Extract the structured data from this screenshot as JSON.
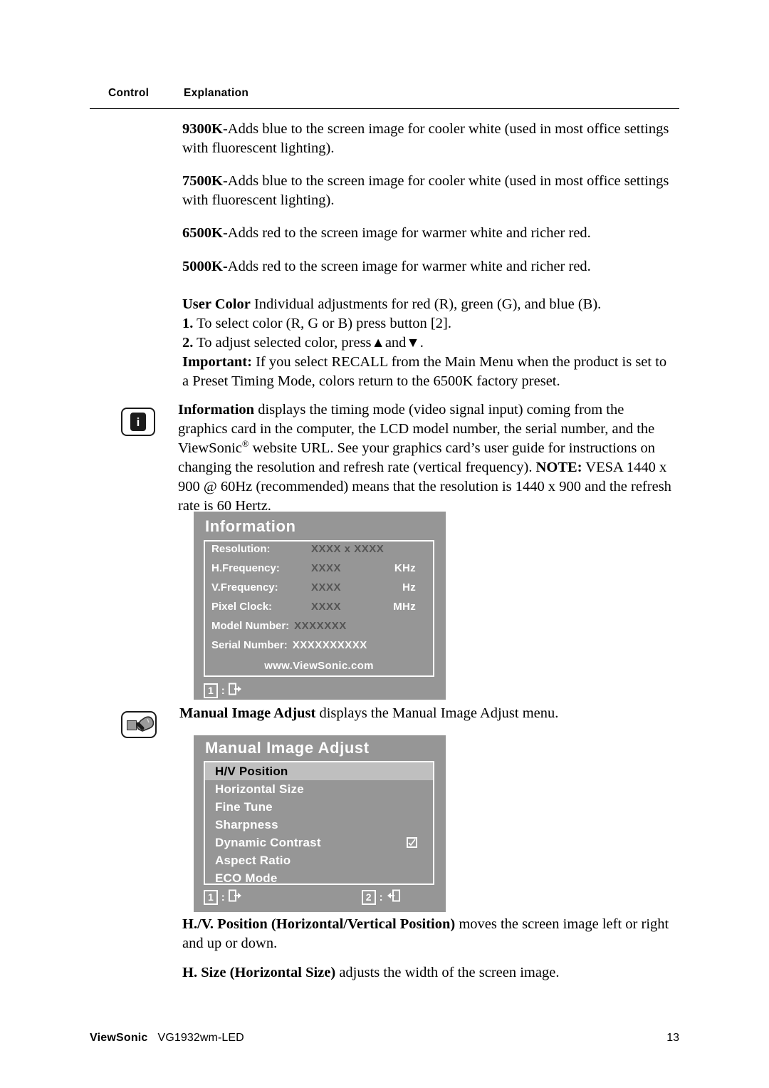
{
  "table_header": {
    "control": "Control",
    "explanation": "Explanation"
  },
  "paragraphs": {
    "p_9300k_term": "9300K-",
    "p_9300k_text": "Adds blue to the screen image for cooler white (used in most office settings with fluorescent lighting).",
    "p_7500k_term": "7500K-",
    "p_7500k_text": "Adds blue to the screen image for cooler white (used in most office settings with fluorescent lighting).",
    "p_6500k_term": "6500K-",
    "p_6500k_text": "Adds red to the screen image for warmer white and richer red.",
    "p_5000k_term": "5000K-",
    "p_5000k_text": "Adds red to the screen image for warmer white and richer red."
  },
  "user_color": {
    "term": "User Color",
    "intro": "Individual adjustments for red (R), green (G),  and blue (B).",
    "step1_num": "1.",
    "step1_text": "To select color (R, G or B) press button [2].",
    "step2_num": "2.",
    "step2_text_a": "To adjust selected color, press",
    "step2_up": "▲",
    "step2_and": "and",
    "step2_down": "▼",
    "step2_end": ".",
    "important_label": "Important:",
    "important_text": "If you select RECALL from the Main Menu when the product is set to a Preset Timing Mode, colors return to the 6500K factory preset."
  },
  "information_section": {
    "icon": "information-icon",
    "icon_glyph": "i",
    "term": "Information",
    "text": "displays the timing mode (video signal input) coming from the graphics card in the computer, the LCD model number, the serial number, and the ViewSonic",
    "registered": "®",
    "text_2": "website URL. See your graphics card’s user guide for instructions on changing the resolution and refresh rate (vertical frequency).",
    "note_label": "NOTE:",
    "note_text": "VESA 1440 x 900 @ 60Hz (recommended) means that the resolution is 1440 x 900 and the refresh rate is 60 Hertz."
  },
  "osd_information": {
    "title": "Information",
    "rows": [
      {
        "label": "Resolution:",
        "value": "XXXX x XXXX",
        "unit": ""
      },
      {
        "label": "H.Frequency:",
        "value": "XXXX",
        "unit": "KHz"
      },
      {
        "label": "V.Frequency:",
        "value": "XXXX",
        "unit": "Hz"
      },
      {
        "label": "Pixel Clock:",
        "value": "XXXX",
        "unit": "MHz"
      },
      {
        "label": "Model Number:",
        "value": "XXXXXXX",
        "unit": ""
      },
      {
        "label": "Serial Number:",
        "value": "XXXXXXXXXX",
        "unit": ""
      }
    ],
    "url": "www.ViewSonic.com",
    "footer": {
      "key1": "1",
      "colon": ":",
      "icon1": "exit-icon"
    }
  },
  "manual_image_adjust_section": {
    "icon": "wrench-tool-icon",
    "term": "Manual Image Adjust",
    "text": "displays the Manual Image Adjust menu."
  },
  "osd_manual_image_adjust": {
    "title": "Manual Image Adjust",
    "items": [
      {
        "label": "H/V Position",
        "selected": true,
        "checkbox": false
      },
      {
        "label": "Horizontal Size",
        "selected": false,
        "checkbox": false
      },
      {
        "label": "Fine Tune",
        "selected": false,
        "checkbox": false
      },
      {
        "label": "Sharpness",
        "selected": false,
        "checkbox": false
      },
      {
        "label": "Dynamic Contrast",
        "selected": false,
        "checkbox": true
      },
      {
        "label": "Aspect Ratio",
        "selected": false,
        "checkbox": false
      },
      {
        "label": "ECO Mode",
        "selected": false,
        "checkbox": false
      }
    ],
    "footer": {
      "key1": "1",
      "colon1": ":",
      "icon1": "exit-icon",
      "key2": "2",
      "colon2": ":",
      "icon2": "enter-icon"
    }
  },
  "hv_position_section": {
    "term": "H./V. Position (Horizontal/Vertical Position)",
    "text": "moves the screen image left or right and up or down."
  },
  "h_size_section": {
    "term": "H. Size (Horizontal Size)",
    "text": "adjusts the width of the screen image."
  },
  "page_footer": {
    "brand": "ViewSonic",
    "model": "VG1932wm-LED",
    "page_number": "13"
  },
  "colors": {
    "osd_background": "#969696",
    "osd_label": "#ffffff",
    "osd_value": "#555555",
    "osd_selected_background": "#bfbfbf",
    "page_background": "#ffffff",
    "text": "#000000"
  }
}
